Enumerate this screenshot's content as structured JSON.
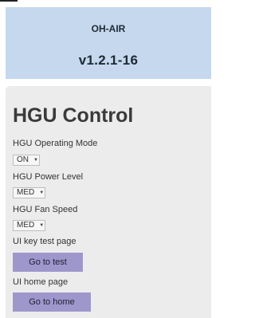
{
  "header": {
    "app_name": "OH-AIR",
    "version": "v1.2.1-16"
  },
  "panel": {
    "title": "HGU Control",
    "operating_mode": {
      "label": "HGU Operating Mode",
      "value": "ON"
    },
    "power_level": {
      "label": "HGU Power Level",
      "value": "MED"
    },
    "fan_speed": {
      "label": "HGU Fan Speed",
      "value": "MED"
    },
    "ui_key_test": {
      "label": "UI key test page",
      "button": "Go to test"
    },
    "ui_home": {
      "label": "UI home page",
      "button": "Go to home"
    }
  },
  "icons": {
    "dropdown": "chevron-down-icon"
  },
  "colors": {
    "header_bg": "#c5d8ed",
    "panel_bg": "#ececec",
    "button_bg": "#9e97cc"
  }
}
